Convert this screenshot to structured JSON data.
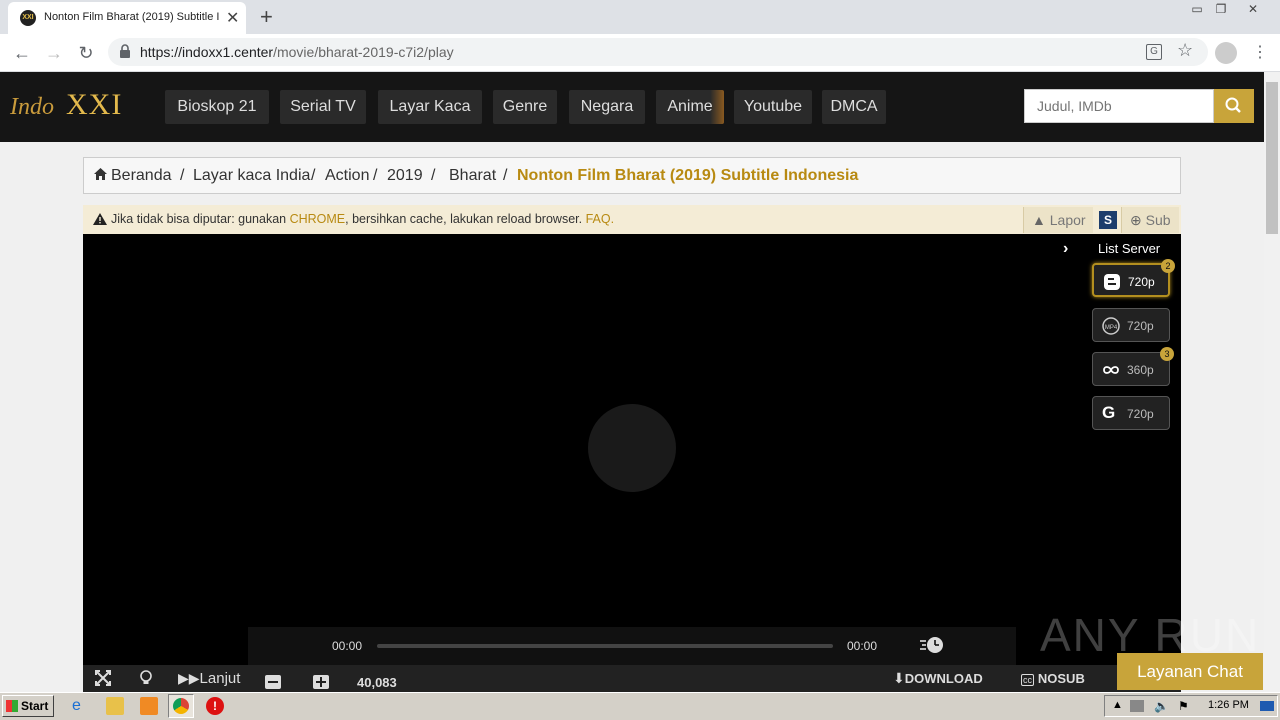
{
  "browser": {
    "tab_title": "Nonton Film Bharat (2019) Subtitle Indonesia",
    "tab_favicon_text": "XXI",
    "url_host": "https://indoxx1.center",
    "url_path": "/movie/bharat-2019-c7i2/play"
  },
  "site": {
    "logo_indo": "Indo",
    "logo_xxi": "XXI",
    "menu": [
      "Bioskop 21",
      "Serial TV",
      "Layar Kaca",
      "Genre",
      "Negara",
      "Anime",
      "Youtube",
      "DMCA"
    ],
    "search_placeholder": "Judul, IMDb"
  },
  "breadcrumb": {
    "home": "Beranda",
    "items": [
      "Layar kaca India",
      "Action",
      "2019",
      "Bharat"
    ],
    "current": "Nonton Film Bharat (2019) Subtitle Indonesia"
  },
  "notice": {
    "prefix": "Jika tidak bisa diputar: gunakan ",
    "chrome": "CHROME",
    "middle": ", bersihkan cache, lakukan reload browser. ",
    "faq": "FAQ.",
    "lapor": "Lapor",
    "s_label": "S",
    "sub": "Sub"
  },
  "player": {
    "list_server_label": "List Server",
    "servers": [
      {
        "quality": "720p",
        "icon": "blogger-icon",
        "badge": "2",
        "active": true
      },
      {
        "quality": "720p",
        "icon": "mp4-icon",
        "badge": "",
        "active": false
      },
      {
        "quality": "360p",
        "icon": "infinity-icon",
        "badge": "3",
        "active": false
      },
      {
        "quality": "720p",
        "icon": "google-icon",
        "badge": "",
        "active": false
      }
    ],
    "time_current": "00:00",
    "time_total": "00:00",
    "lanjut": "Lanjut",
    "counter": "40,083",
    "download": "DOWNLOAD",
    "nosub": "NOSUB"
  },
  "overlay": {
    "watermark": "ANY RUN",
    "chat": "Layanan Chat"
  },
  "taskbar": {
    "start": "Start",
    "clock": "1:26 PM"
  },
  "colors": {
    "accent": "#c8a43a",
    "crumb_active": "#b88a12"
  }
}
